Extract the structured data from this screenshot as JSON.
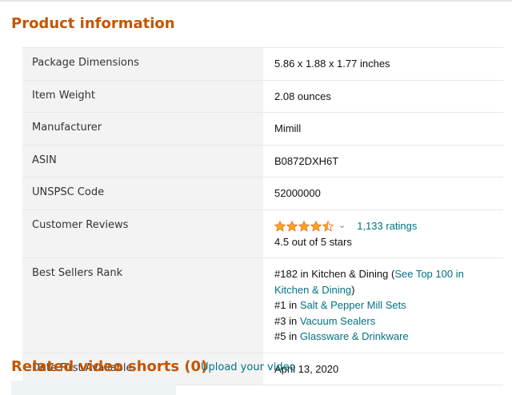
{
  "section_title": "Product information",
  "rows": {
    "dimensions": {
      "label": "Package Dimensions",
      "value": "5.86 x 1.88 x 1.77 inches"
    },
    "weight": {
      "label": "Item Weight",
      "value": "2.08 ounces"
    },
    "manufacturer": {
      "label": "Manufacturer",
      "value": "Mimill"
    },
    "asin": {
      "label": "ASIN",
      "value": "B0872DXH6T"
    },
    "unspsc": {
      "label": "UNSPSC Code",
      "value": "52000000"
    },
    "reviews": {
      "label": "Customer Reviews",
      "rating": 4.5,
      "ratings_count": "1,133 ratings",
      "summary": "4.5 out of 5 stars",
      "star_color": "#ffa41c",
      "star_icon": "star-icon"
    },
    "bsr": {
      "label": "Best Sellers Rank",
      "line1_prefix": "#182 in Kitchen & Dining (",
      "line1_link": "See Top 100 in Kitchen & Dining",
      "line1_suffix": ")",
      "line2_prefix": "#1 in ",
      "line2_link": "Salt & Pepper Mill Sets",
      "line3_prefix": "#3 in ",
      "line3_link": "Vacuum Sealers",
      "line4_prefix": "#5 in ",
      "line4_link": "Glassware & Drinkware"
    },
    "date": {
      "label": "Date First Available",
      "value": "April 13, 2020"
    }
  },
  "video_section": {
    "title": "Related video shorts (0)",
    "upload_link": "Upload your video"
  },
  "colors": {
    "title": "#c45500",
    "link": "#007185",
    "label_bg": "#f3f3f3"
  }
}
